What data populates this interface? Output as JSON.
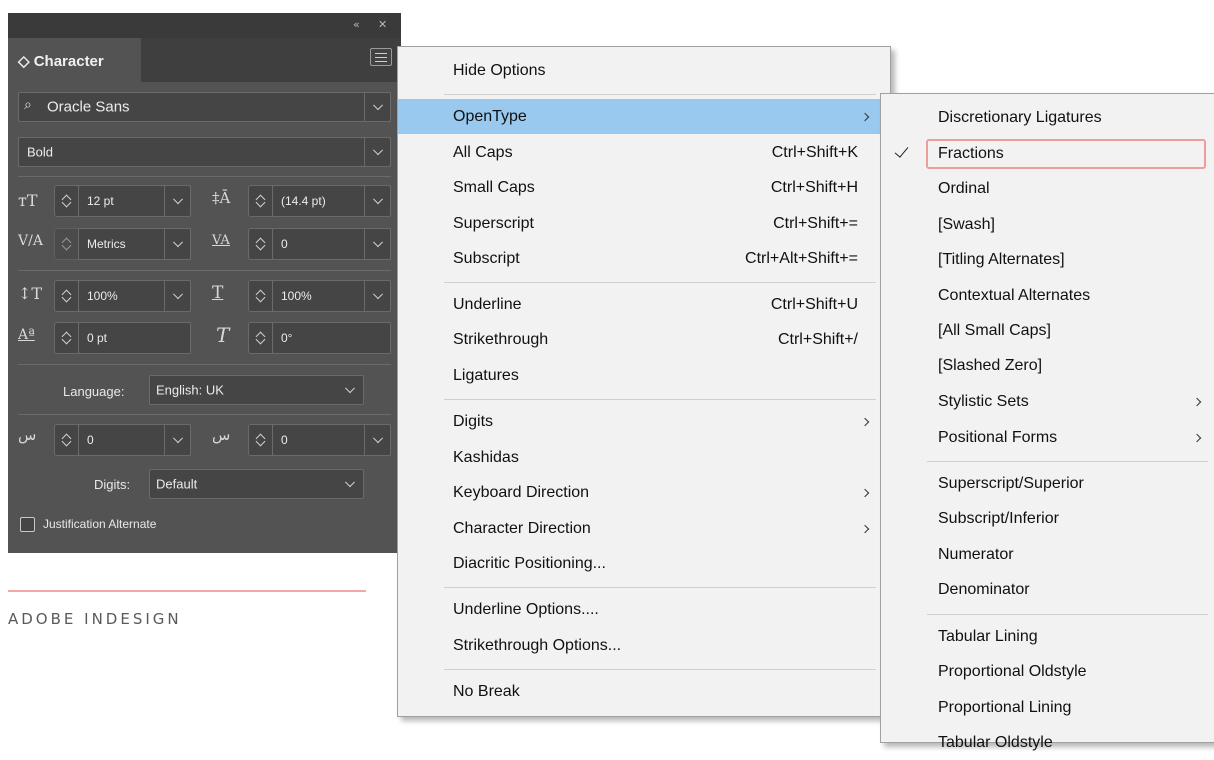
{
  "panel": {
    "collapse_glyph": "«",
    "close_glyph": "✕",
    "tab_title": "◇ Character",
    "font_family": "Oracle Sans",
    "font_style": "Bold",
    "size": "12 pt",
    "leading": "(14.4 pt)",
    "kerning": "Metrics",
    "tracking": "0",
    "vertical_scale": "100%",
    "horizontal_scale": "100%",
    "baseline_shift": "0 pt",
    "skew": "0°",
    "language_label": "Language:",
    "language_value": "English: UK",
    "kashida_left": "0",
    "kashida_right": "0",
    "digits_label": "Digits:",
    "digits_value": "Default",
    "justification_alternate": "Justification Alternate"
  },
  "caption": "ADOBE INDESIGN",
  "main_menu": {
    "items": [
      {
        "label": "Hide Options",
        "shortcut": ""
      },
      {
        "label": "OpenType",
        "shortcut": "",
        "submenu": true,
        "highlighted": true
      },
      {
        "label": "All Caps",
        "shortcut": "Ctrl+Shift+K"
      },
      {
        "label": "Small Caps",
        "shortcut": "Ctrl+Shift+H"
      },
      {
        "label": "Superscript",
        "shortcut": "Ctrl+Shift+="
      },
      {
        "label": "Subscript",
        "shortcut": "Ctrl+Alt+Shift+="
      },
      {
        "label": "Underline",
        "shortcut": "Ctrl+Shift+U"
      },
      {
        "label": "Strikethrough",
        "shortcut": "Ctrl+Shift+/"
      },
      {
        "label": "Ligatures",
        "shortcut": ""
      },
      {
        "label": "Digits",
        "shortcut": "",
        "submenu": true
      },
      {
        "label": "Kashidas",
        "shortcut": ""
      },
      {
        "label": "Keyboard Direction",
        "shortcut": "",
        "submenu": true
      },
      {
        "label": "Character Direction",
        "shortcut": "",
        "submenu": true
      },
      {
        "label": "Diacritic Positioning...",
        "shortcut": ""
      },
      {
        "label": "Underline Options....",
        "shortcut": ""
      },
      {
        "label": "Strikethrough Options...",
        "shortcut": ""
      },
      {
        "label": "No Break",
        "shortcut": ""
      }
    ]
  },
  "opentype_menu": {
    "items": [
      {
        "label": "Discretionary Ligatures"
      },
      {
        "label": "Fractions",
        "checked": true
      },
      {
        "label": "Ordinal"
      },
      {
        "label": "[Swash]"
      },
      {
        "label": "[Titling Alternates]"
      },
      {
        "label": "Contextual Alternates"
      },
      {
        "label": "[All Small Caps]"
      },
      {
        "label": "[Slashed Zero]"
      },
      {
        "label": "Stylistic Sets",
        "submenu": true
      },
      {
        "label": "Positional Forms",
        "submenu": true
      },
      {
        "label": "Superscript/Superior"
      },
      {
        "label": "Subscript/Inferior"
      },
      {
        "label": "Numerator"
      },
      {
        "label": "Denominator"
      },
      {
        "label": "Tabular Lining"
      },
      {
        "label": "Proportional Oldstyle"
      },
      {
        "label": "Proportional Lining"
      },
      {
        "label": "Tabular Oldstyle"
      }
    ]
  }
}
